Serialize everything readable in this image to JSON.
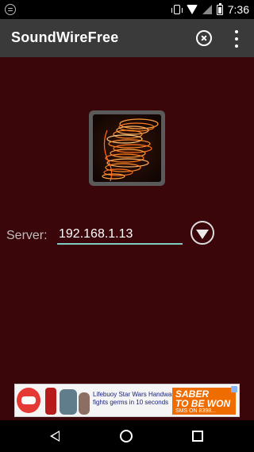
{
  "status_bar": {
    "time": "7:36",
    "icons": [
      "spotify-icon",
      "vibrate-icon",
      "wifi-icon",
      "signal-icon",
      "battery-icon"
    ]
  },
  "app_bar": {
    "title": "SoundWireFree",
    "close_icon": "close-circle-icon",
    "menu_icon": "overflow-menu-icon"
  },
  "main": {
    "background_color": "#3a0609",
    "logo_icon": "spiral-waves-icon",
    "server_label": "Server:",
    "server_value": "192.168.1.13",
    "dropdown_icon": "dropdown-circle-icon"
  },
  "ad": {
    "brand": "Lifebuoy",
    "line1": "Lifebuoy Star Wars Handwash",
    "line2": "fights germs in 10 seconds",
    "badge_line1": "SABER",
    "badge_line2": "TO BE WON",
    "badge_line3": "SMS ON 8398..."
  },
  "nav_bar": {
    "icons": [
      "back-icon",
      "home-icon",
      "recents-icon"
    ]
  }
}
